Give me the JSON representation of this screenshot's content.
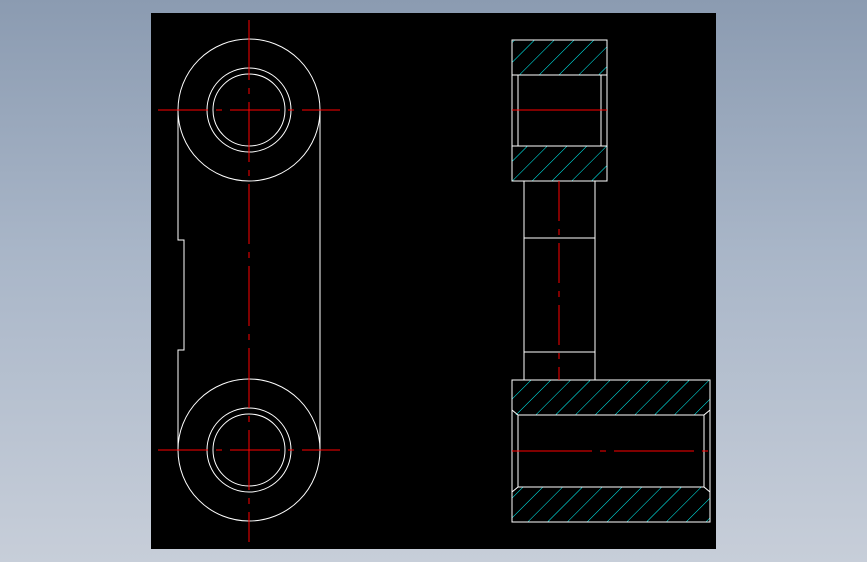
{
  "app": {
    "background_top": "#8b9bb1",
    "background_bottom": "#c7ced9",
    "viewport_color": "#000000"
  },
  "drawing": {
    "outline_color": "#ffffff",
    "centerline_color": "#ff0000",
    "hatch_color": "#00ffff",
    "views": [
      {
        "name": "front-view",
        "description_visible": false
      },
      {
        "name": "side-section-view",
        "description_visible": false
      }
    ]
  }
}
